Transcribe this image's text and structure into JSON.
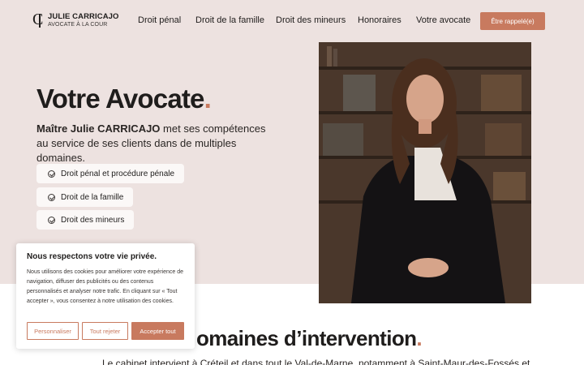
{
  "brand": {
    "name": "JULIE CARRICAJO",
    "subtitle": "AVOCATE À LA COUR"
  },
  "nav": {
    "items": [
      "Droit pénal",
      "Droit de la famille",
      "Droit des mineurs",
      "Honoraires",
      "Votre avocate"
    ],
    "cta": "Être rappelé(e)"
  },
  "hero": {
    "title": "Votre Avocate",
    "title_dot": ".",
    "desc_bold": "Maître Julie CARRICAJO",
    "desc_rest": " met ses compétences au service de ses clients dans de multiples domaines.",
    "pills": [
      "Droit pénal et procédure pénale",
      "Droit de la famille",
      "Droit des mineurs"
    ]
  },
  "section": {
    "title": "omaines d’intervention",
    "title_dot": ".",
    "desc": "Le cabinet intervient à Créteil et dans tout le Val-de-Marne, notamment à Saint-Maur-des-Fossés et"
  },
  "cookie": {
    "title": "Nous respectons votre vie privée.",
    "text": "Nous utilisons des cookies pour améliorer votre expérience de navigation, diffuser des publicités ou des contenus personnalisés et analyser notre trafic. En cliquant sur « Tout accepter », vous consentez à notre utilisation des cookies.",
    "buttons": {
      "customize": "Personnaliser",
      "reject": "Tout rejeter",
      "accept": "Accepter tout"
    }
  },
  "colors": {
    "accent": "#c87a5f",
    "hero_bg": "#ede2e0",
    "text": "#1f1d1c"
  },
  "icons": {
    "pill": "check-circle-icon"
  }
}
